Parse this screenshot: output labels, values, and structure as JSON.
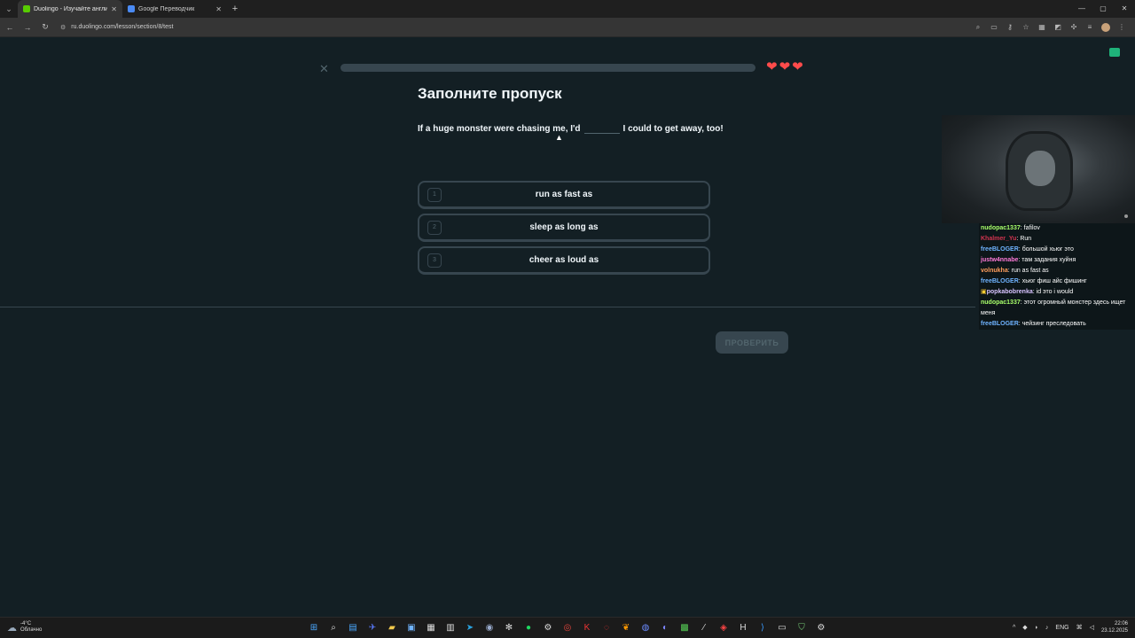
{
  "browser": {
    "tabs": [
      {
        "title": "Duolingo - Изучайте английск",
        "favicon_color": "#58cc02",
        "active": true
      },
      {
        "title": "Google Переводчик",
        "favicon_color": "#4a8af4",
        "active": false
      }
    ],
    "new_tab": "+",
    "url": "ru.duolingo.com/lesson/section/8/test"
  },
  "lesson": {
    "close_symbol": "✕",
    "hearts": [
      "❤",
      "❤",
      "❤"
    ],
    "title": "Заполните пропуск",
    "sentence_before": "If a huge monster were chasing me, I'd",
    "sentence_after": "I could to get away, too!",
    "options": [
      {
        "number": "1",
        "label": "run as fast as"
      },
      {
        "number": "2",
        "label": "sleep as long as"
      },
      {
        "number": "3",
        "label": "cheer as loud as"
      }
    ],
    "check_button": "ПРОВЕРИТЬ"
  },
  "chat": {
    "messages": [
      {
        "user": "nudopac1337",
        "text": "fafilov",
        "color": "#a8ff6a"
      },
      {
        "user": "Khalmer_Yu",
        "text": "Run",
        "color": "#d1344f"
      },
      {
        "user": "freeBLOGER",
        "text": "большой хьюг это",
        "color": "#6fb3ff"
      },
      {
        "user": "justw4nnabe",
        "text": "там задания хуйня",
        "color": "#ff7ad9"
      },
      {
        "user": "volnukha",
        "text": "run as fast as",
        "color": "#ff9d5c"
      },
      {
        "user": "freeBLOGER",
        "text": "хьюг фиш айс фишинг",
        "color": "#6fb3ff"
      },
      {
        "user": "popkabobrenka",
        "text": "id это i would",
        "color": "#d8c3ff"
      },
      {
        "user": "nudopac1337",
        "text": "этот огромный монстер здесь ищет меня",
        "color": "#a8ff6a"
      },
      {
        "user": "freeBLOGER",
        "text": "чейзинг преследовать",
        "color": "#6fb3ff"
      }
    ]
  },
  "taskbar": {
    "weather_temp": "-4°C",
    "weather_desc": "Облачно",
    "lang": "ENG",
    "time": "22:06",
    "date": "23.12.2025"
  }
}
